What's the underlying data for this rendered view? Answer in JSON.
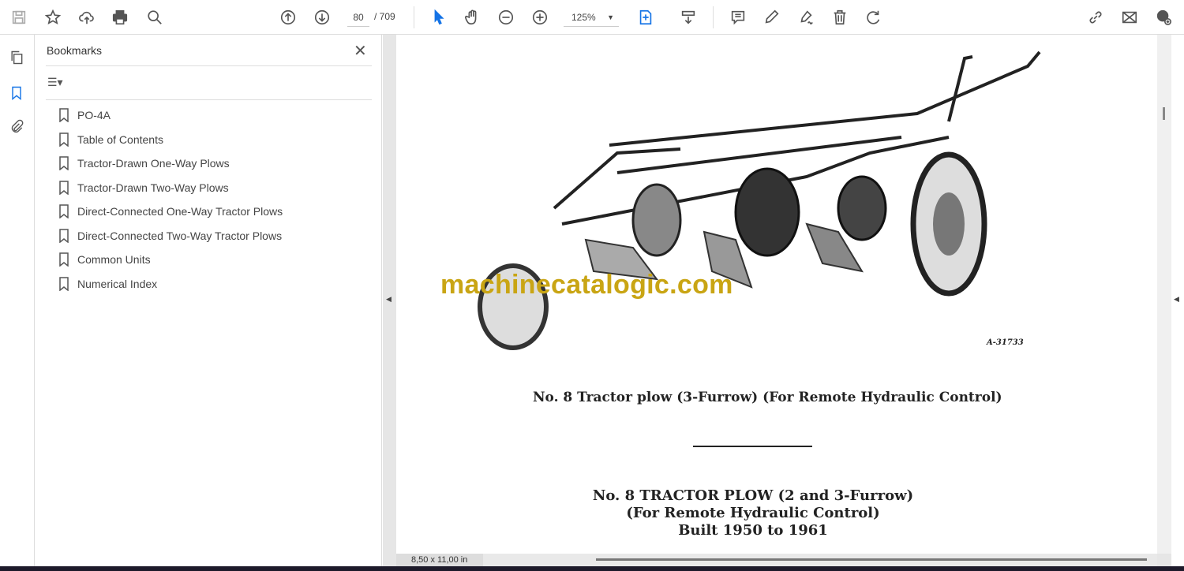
{
  "toolbar": {
    "page_current": "80",
    "page_total": "/ 709",
    "zoom": "125%"
  },
  "bookmarks": {
    "title": "Bookmarks",
    "close": "✕",
    "options": "☰▾",
    "items": [
      "PO-4A",
      "Table of Contents",
      "Tractor-Drawn One-Way Plows",
      "Tractor-Drawn Two-Way Plows",
      "Direct-Connected One-Way Tractor Plows",
      "Direct-Connected Two-Way Tractor Plows",
      "Common Units",
      "Numerical Index"
    ]
  },
  "document": {
    "figure_id": "A-31733",
    "caption": "No. 8 Tractor plow (3-Furrow) (For Remote Hydraulic Control)",
    "heading1": "No. 8 TRACTOR PLOW (2 and 3-Furrow)",
    "heading2": "(For Remote Hydraulic Control)",
    "heading3": "Built 1950 to 1961",
    "watermark": "machinecatalogic.com"
  },
  "status": {
    "page_size": "8,50 x 11,00 in"
  },
  "colors": {
    "accent": "#1473e6",
    "watermark": "#c9a514"
  }
}
